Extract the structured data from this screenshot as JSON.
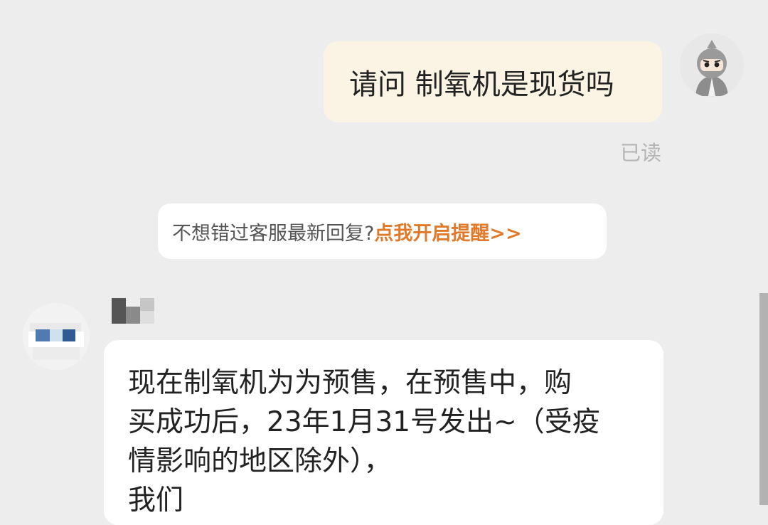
{
  "conversation": {
    "outgoing": {
      "text": "请问 制氧机是现货吗",
      "status": "已读"
    },
    "notice": {
      "text": "不想错过客服最新回复?",
      "link": "点我开启提醒>>"
    },
    "incoming": {
      "lines": [
        "现在制氧机为为预售，在预售中，购",
        "买成功后，23年1月31号发出~（受疫",
        "情影响的地区除外），",
        "我们"
      ]
    }
  },
  "colors": {
    "background": "#ededed",
    "outgoing_bubble": "#fbf3e3",
    "incoming_bubble": "#ffffff",
    "link_accent": "#e07a2a"
  },
  "icons": {
    "user_avatar": "ninja-avatar-icon",
    "agent_avatar": "pixelated-avatar-icon"
  }
}
